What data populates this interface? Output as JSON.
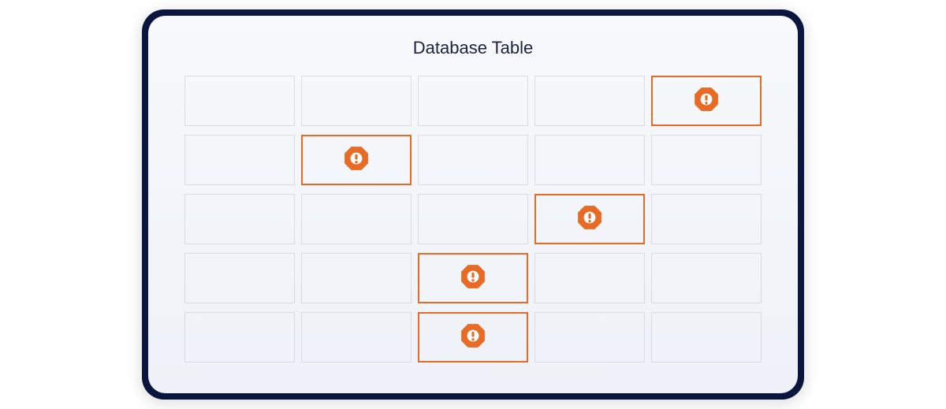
{
  "title": "Database Table",
  "colors": {
    "frame": "#0b163f",
    "panel_top": "#f7f9fc",
    "panel_bottom": "#eef1f7",
    "cell_border": "#d8dbe2",
    "error": "#e96a24"
  },
  "grid": {
    "rows": 5,
    "cols": 5,
    "cells": [
      [
        {
          "error": false
        },
        {
          "error": false
        },
        {
          "error": false
        },
        {
          "error": false
        },
        {
          "error": true
        }
      ],
      [
        {
          "error": false
        },
        {
          "error": true
        },
        {
          "error": false
        },
        {
          "error": false
        },
        {
          "error": false
        }
      ],
      [
        {
          "error": false
        },
        {
          "error": false
        },
        {
          "error": false
        },
        {
          "error": true
        },
        {
          "error": false
        }
      ],
      [
        {
          "error": false
        },
        {
          "error": false
        },
        {
          "error": true
        },
        {
          "error": false
        },
        {
          "error": false
        }
      ],
      [
        {
          "error": false
        },
        {
          "error": false
        },
        {
          "error": true
        },
        {
          "error": false
        },
        {
          "error": false
        }
      ]
    ]
  },
  "icon_name": "error-octagon-icon"
}
